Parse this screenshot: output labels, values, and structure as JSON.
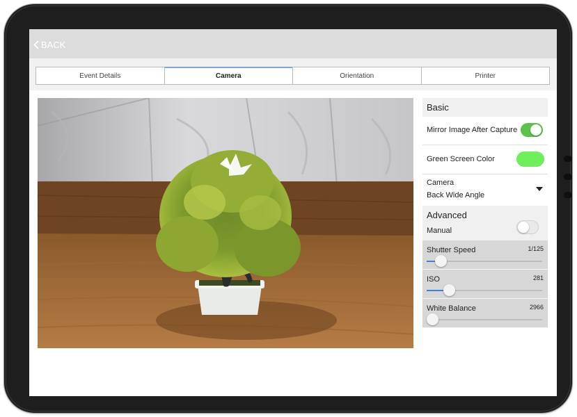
{
  "nav": {
    "back_label": "BACK"
  },
  "tabs": [
    {
      "label": "Event Details",
      "active": false
    },
    {
      "label": "Camera",
      "active": true
    },
    {
      "label": "Orientation",
      "active": false
    },
    {
      "label": "Printer",
      "active": false
    }
  ],
  "basic": {
    "heading": "Basic",
    "mirror_label": "Mirror Image After Capture",
    "mirror_on": true,
    "green_label": "Green Screen Color",
    "green_color": "#6df05b",
    "camera_label": "Camera",
    "camera_value": "Back Wide Angle"
  },
  "advanced": {
    "heading": "Advanced",
    "manual_label": "Manual",
    "manual_on": false,
    "sliders": [
      {
        "label": "Shutter Speed",
        "value": "1/125",
        "level": 0.12
      },
      {
        "label": "ISO",
        "value": "281",
        "level": 0.19
      },
      {
        "label": "White Balance",
        "value": "2966",
        "level": 0.05
      }
    ]
  },
  "colors": {
    "accent": "#3f7ee0",
    "toggle_on": "#5cc24b"
  }
}
